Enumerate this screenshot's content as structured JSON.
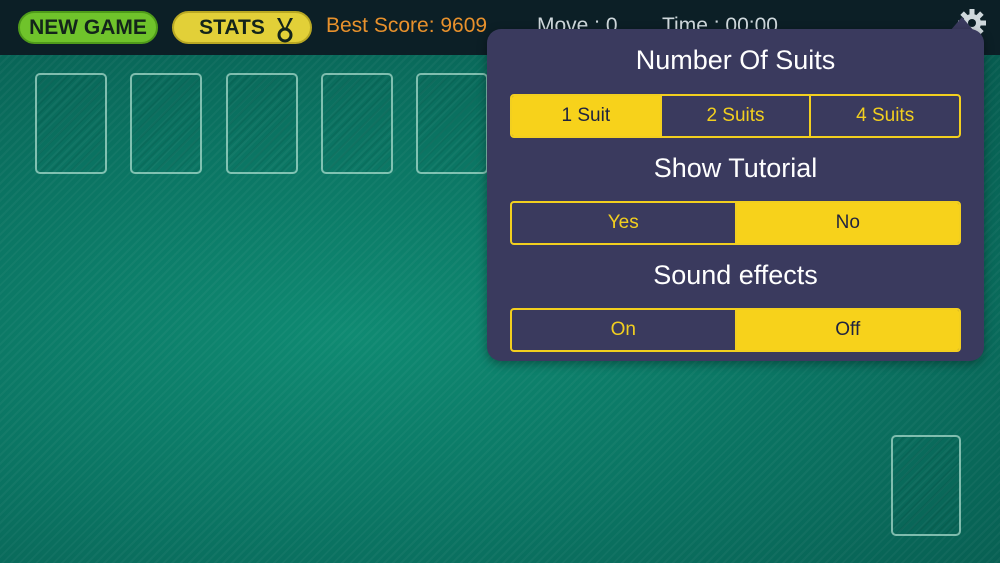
{
  "colors": {
    "felt": "#0a6e5f",
    "topbar": "#0c1f26",
    "new_game_green": "#6fc32b",
    "stats_yellow": "#e2d038",
    "score_orange": "#e8912c",
    "popup_bg": "#3a3a5e",
    "accent_yellow": "#f7d21b"
  },
  "topbar": {
    "new_game_label": "NEW GAME",
    "stats_label": "STATS",
    "stats_icon": "medal-icon",
    "best_score": "Best Score: 9609",
    "moves": "Move : 0",
    "time": "Time : 00:00",
    "settings_icon": "gear-icon"
  },
  "settings_popup": {
    "suits": {
      "title": "Number Of Suits",
      "options": [
        "1 Suit",
        "2 Suits",
        "4 Suits"
      ],
      "selected": "1 Suit"
    },
    "tutorial": {
      "title": "Show Tutorial",
      "options": [
        "Yes",
        "No"
      ],
      "selected": "No"
    },
    "sound": {
      "title": "Sound effects",
      "options": [
        "On",
        "Off"
      ],
      "selected": "Off"
    }
  }
}
